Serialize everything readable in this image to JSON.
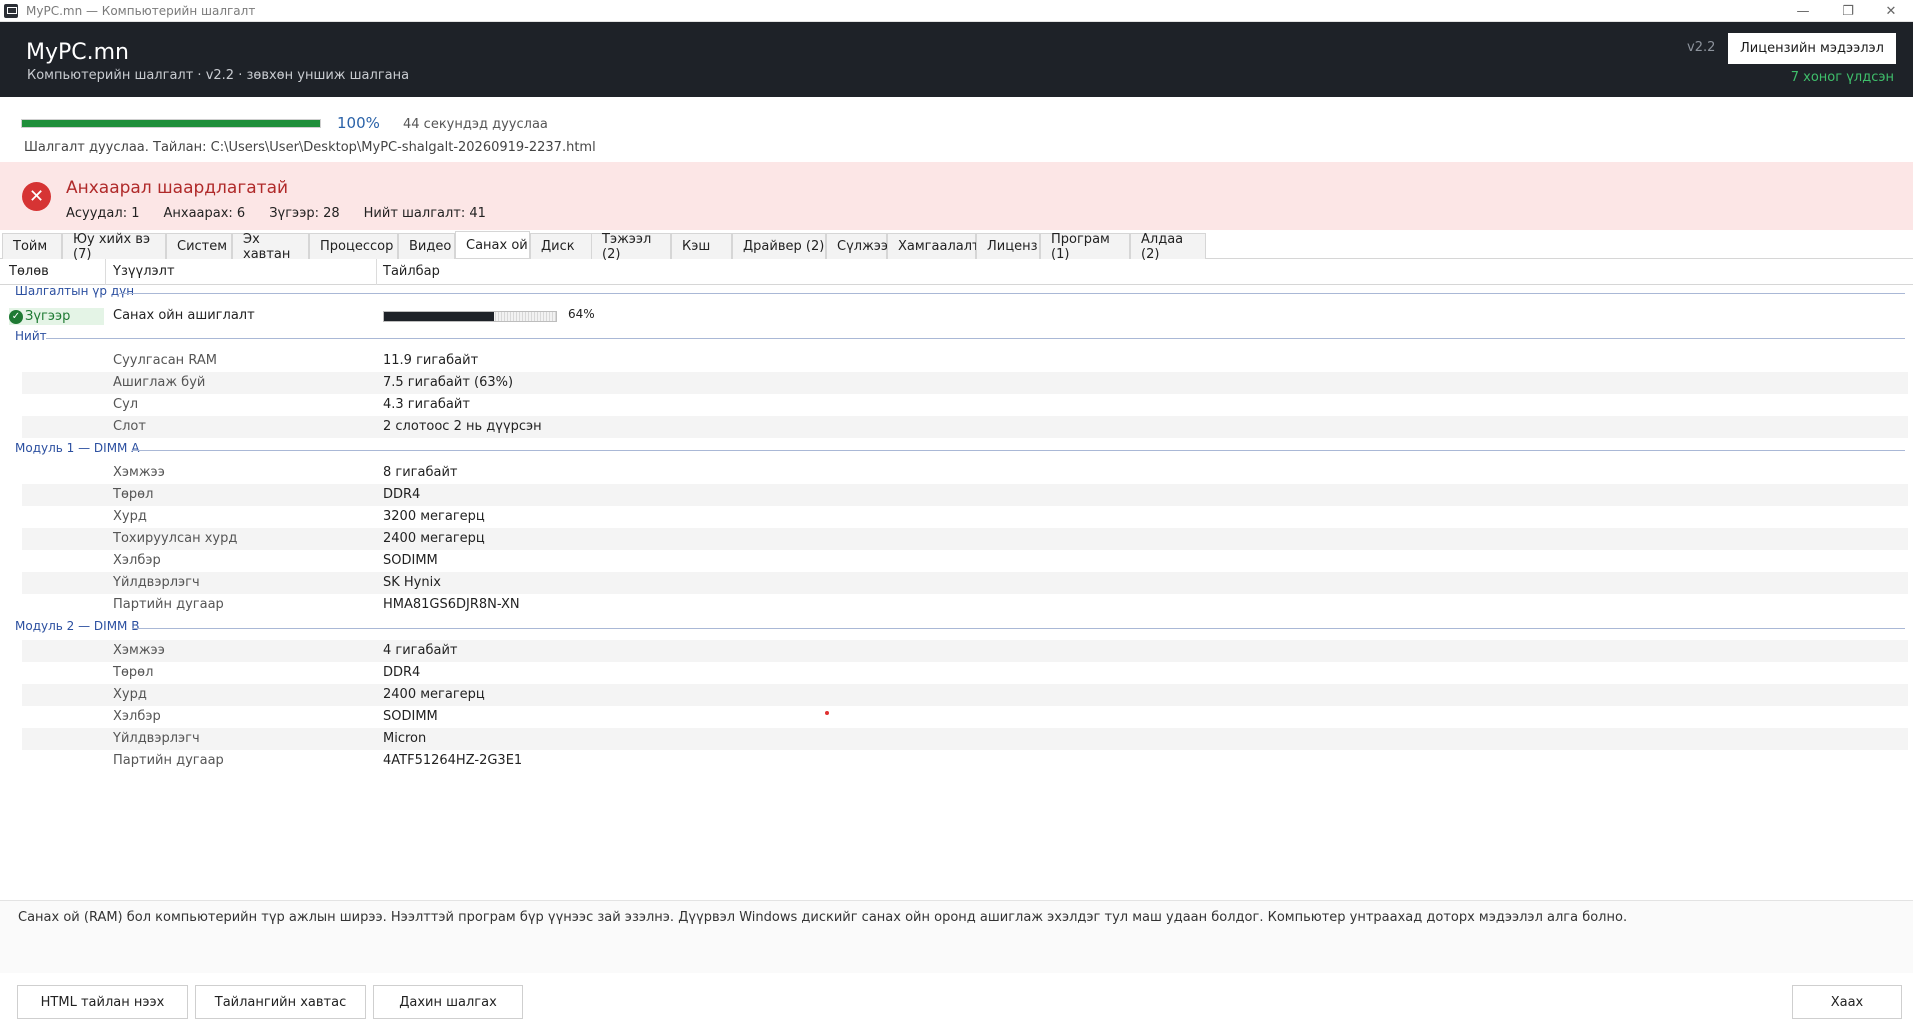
{
  "window": {
    "title": "MyPC.mn — Компьютерийн шалгалт"
  },
  "header": {
    "brand": "MyPC.mn",
    "subtitle": "Компьютерийн шалгалт · v2.2 · зөвхөн уншиж шалгана",
    "version": "v2.2",
    "license_button": "Лицензийн мэдээлэл",
    "days_left": "7 хоног үлдсэн"
  },
  "progress": {
    "value": 1.0,
    "percent_label": "100%",
    "time_label": "44 секундэд дууслаа",
    "status": "Шалгалт дууслаа. Тайлан: C:\\Users\\User\\Desktop\\MyPC-shalgalt-20260919-2237.html"
  },
  "alert": {
    "title": "Анхаарал шаардлагатай",
    "counts": [
      "Асуудал: 1",
      "Анхаарах: 6",
      "Зүгээр: 28",
      "Нийт шалгалт: 41"
    ]
  },
  "tabs": [
    "Тойм",
    "Юу хийх вэ (7)",
    "Систем",
    "Эх хавтан",
    "Процессор",
    "Видео",
    "Санах ой",
    "Диск",
    "Тэжээл (2)",
    "Кэш",
    "Драйвер (2)",
    "Сүлжээ",
    "Хамгаалалт",
    "Лиценз",
    "Програм (1)",
    "Алдаа (2)"
  ],
  "active_tab": "Санах ой",
  "table": {
    "columns": [
      "Төлөв",
      "Үзүүлэлт",
      "Тайлбар"
    ],
    "sections": [
      {
        "title": "Шалгалтын үр дүн",
        "result": {
          "status": "Зүгээр",
          "label": "Санах ойн ашиглалт",
          "usage": 0.64,
          "usage_label": "64%"
        }
      },
      {
        "title": "Нийт",
        "rows": [
          {
            "k": "Суулгасан RAM",
            "v": "11.9 гигабайт"
          },
          {
            "k": "Ашиглаж буй",
            "v": "7.5 гигабайт (63%)"
          },
          {
            "k": "Сул",
            "v": "4.3 гигабайт"
          },
          {
            "k": "Слот",
            "v": "2 слотоос 2 нь дүүрсэн"
          }
        ]
      },
      {
        "title": "Модуль 1 — DIMM A",
        "rows": [
          {
            "k": "Хэмжээ",
            "v": "8 гигабайт"
          },
          {
            "k": "Төрөл",
            "v": "DDR4"
          },
          {
            "k": "Хурд",
            "v": "3200 мегагерц"
          },
          {
            "k": "Тохируулсан хурд",
            "v": "2400 мегагерц"
          },
          {
            "k": "Хэлбэр",
            "v": "SODIMM"
          },
          {
            "k": "Үйлдвэрлэгч",
            "v": "SK Hynix"
          },
          {
            "k": "Партийн дугаар",
            "v": "HMA81GS6DJR8N-XN"
          }
        ]
      },
      {
        "title": "Модуль 2 — DIMM B",
        "rows": [
          {
            "k": "Хэмжээ",
            "v": "4 гигабайт"
          },
          {
            "k": "Төрөл",
            "v": "DDR4"
          },
          {
            "k": "Хурд",
            "v": "2400 мегагерц"
          },
          {
            "k": "Хэлбэр",
            "v": "SODIMM"
          },
          {
            "k": "Үйлдвэрлэгч",
            "v": "Micron"
          },
          {
            "k": "Партийн дугаар",
            "v": "4ATF51264HZ-2G3E1"
          }
        ]
      }
    ]
  },
  "description": "Санах ой (RAM) бол компьютерийн түр ажлын ширээ. Нээлттэй програм бүр үүнээс зай эзэлнэ. Дүүрвэл Windows дискийг санах ойн оронд ашиглаж эхэлдэг тул маш удаан болдог. Компьютер унтраахад доторх мэдээлэл алга болно.",
  "buttons": {
    "open_report": "HTML тайлан нээх",
    "report_folder": "Тайлангийн хавтас",
    "recheck": "Дахин шалгах",
    "close": "Хаах"
  },
  "colors": {
    "header_bg": "#1e2228",
    "progress_green": "#1f8f3a",
    "alert_bg": "#fce6e6",
    "alert_red": "#d63434",
    "ok_green": "#1e7a33",
    "section_blue": "#2b4fa0"
  },
  "icons": {
    "app": "computer-icon",
    "alert": "error-x-icon",
    "ok": "check-circle-icon"
  }
}
